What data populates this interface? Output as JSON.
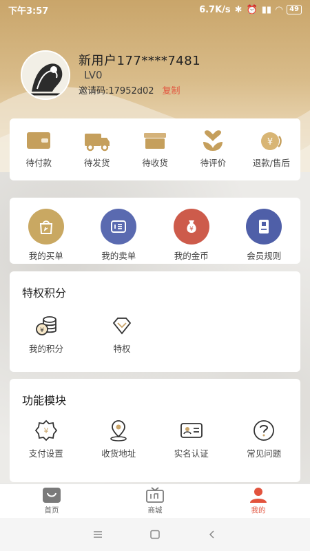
{
  "status_bar": {
    "time": "下午3:57",
    "net_speed": "6.7K/s",
    "battery": "49"
  },
  "profile": {
    "username": "新用户177****7481",
    "level": "LV0",
    "invite_label": "邀请码:17952d02",
    "copy_label": "复制"
  },
  "orders": [
    {
      "label": "待付款",
      "icon": "wallet-icon"
    },
    {
      "label": "待发货",
      "icon": "truck-icon"
    },
    {
      "label": "待收货",
      "icon": "package-icon"
    },
    {
      "label": "待评价",
      "icon": "heart-flower-icon"
    },
    {
      "label": "退款/售后",
      "icon": "refund-icon"
    }
  ],
  "services": [
    {
      "label": "我的买单",
      "icon": "shopping-bag-icon",
      "color": "#c9a862"
    },
    {
      "label": "我的卖单",
      "icon": "sell-list-icon",
      "color": "#5a6ab0"
    },
    {
      "label": "我的金币",
      "icon": "money-bag-icon",
      "color": "#cd5b4b"
    },
    {
      "label": "会员规则",
      "icon": "rules-book-icon",
      "color": "#4f5fa8"
    }
  ],
  "privilege": {
    "title": "特权积分",
    "items": [
      {
        "label": "我的积分",
        "icon": "coins-icon"
      },
      {
        "label": "特权",
        "icon": "diamond-icon"
      }
    ]
  },
  "functions": {
    "title": "功能模块",
    "items": [
      {
        "label": "支付设置",
        "icon": "payment-gear-icon"
      },
      {
        "label": "收货地址",
        "icon": "location-icon"
      },
      {
        "label": "实名认证",
        "icon": "id-card-icon"
      },
      {
        "label": "常见问题",
        "icon": "question-icon"
      }
    ]
  },
  "tabbar": [
    {
      "label": "首页",
      "icon": "home-bag-icon"
    },
    {
      "label": "商城",
      "icon": "mall-tv-icon"
    },
    {
      "label": "我的",
      "icon": "user-icon",
      "active": true
    }
  ],
  "colors": {
    "gold": "#c9a56a",
    "accent_red": "#e2533d"
  }
}
